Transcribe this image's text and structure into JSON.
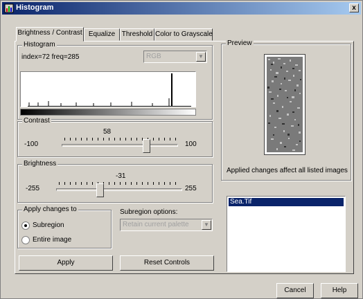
{
  "window": {
    "title": "Histogram",
    "close_label": "x"
  },
  "tabs": [
    {
      "label": "Brightness / Contrast",
      "active": true
    },
    {
      "label": "Equalize",
      "active": false
    },
    {
      "label": "Threshold",
      "active": false
    },
    {
      "label": "Color to Grayscale",
      "active": false
    }
  ],
  "histogram": {
    "group_label": "Histogram",
    "readout": "index=72 freq=285",
    "channel_select": "RGB"
  },
  "contrast": {
    "group_label": "Contrast",
    "value": "58",
    "min": "-100",
    "max": "100",
    "level": 0.79
  },
  "brightness": {
    "group_label": "Brightness",
    "value": "-31",
    "min": "-255",
    "max": "255",
    "level": 0.44
  },
  "apply_changes": {
    "group_label": "Apply changes to",
    "option_subregion": "Subregion",
    "option_entire": "Entire image",
    "selected": "Subregion"
  },
  "subregion_options": {
    "label": "Subregion options:",
    "select_value": "Retain current palette"
  },
  "buttons": {
    "apply": "Apply",
    "reset": "Reset Controls",
    "cancel": "Cancel",
    "help": "Help"
  },
  "preview": {
    "group_label": "Preview",
    "note": "Applied changes affect all listed images",
    "list_items": [
      "Sea.Tif"
    ]
  }
}
